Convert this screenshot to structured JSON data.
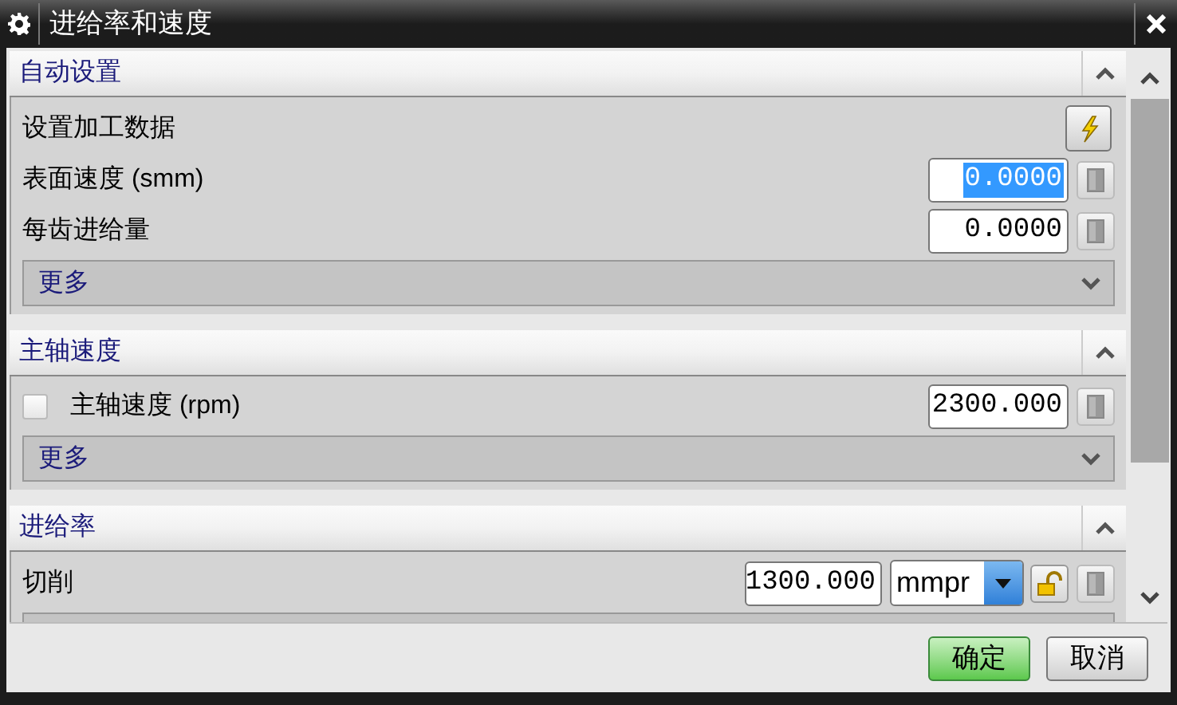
{
  "window": {
    "title": "进给率和速度"
  },
  "sections": [
    {
      "title": "自动设置",
      "expanded": true,
      "rows": [
        {
          "kind": "action",
          "label": "设置加工数据"
        },
        {
          "kind": "number",
          "label": "表面速度 (smm)",
          "value": "0.0000",
          "selected": true
        },
        {
          "kind": "number",
          "label": "每齿进给量",
          "value": "0.0000",
          "selected": false
        },
        {
          "kind": "more",
          "label": "更多",
          "expanded": false
        }
      ]
    },
    {
      "title": "主轴速度",
      "expanded": true,
      "rows": [
        {
          "kind": "checkbox",
          "label": "主轴速度 (rpm)",
          "checked": false,
          "value": "2300.000"
        },
        {
          "kind": "more",
          "label": "更多",
          "expanded": false
        }
      ]
    },
    {
      "title": "进给率",
      "expanded": true,
      "rows": [
        {
          "kind": "feed",
          "label": "切削",
          "value": "1300.000",
          "unit": "mmpr",
          "locked": false
        },
        {
          "kind": "more"
        }
      ]
    }
  ],
  "buttons": [
    {
      "label": "确定",
      "default": true
    },
    {
      "label": "取消",
      "default": false
    }
  ]
}
